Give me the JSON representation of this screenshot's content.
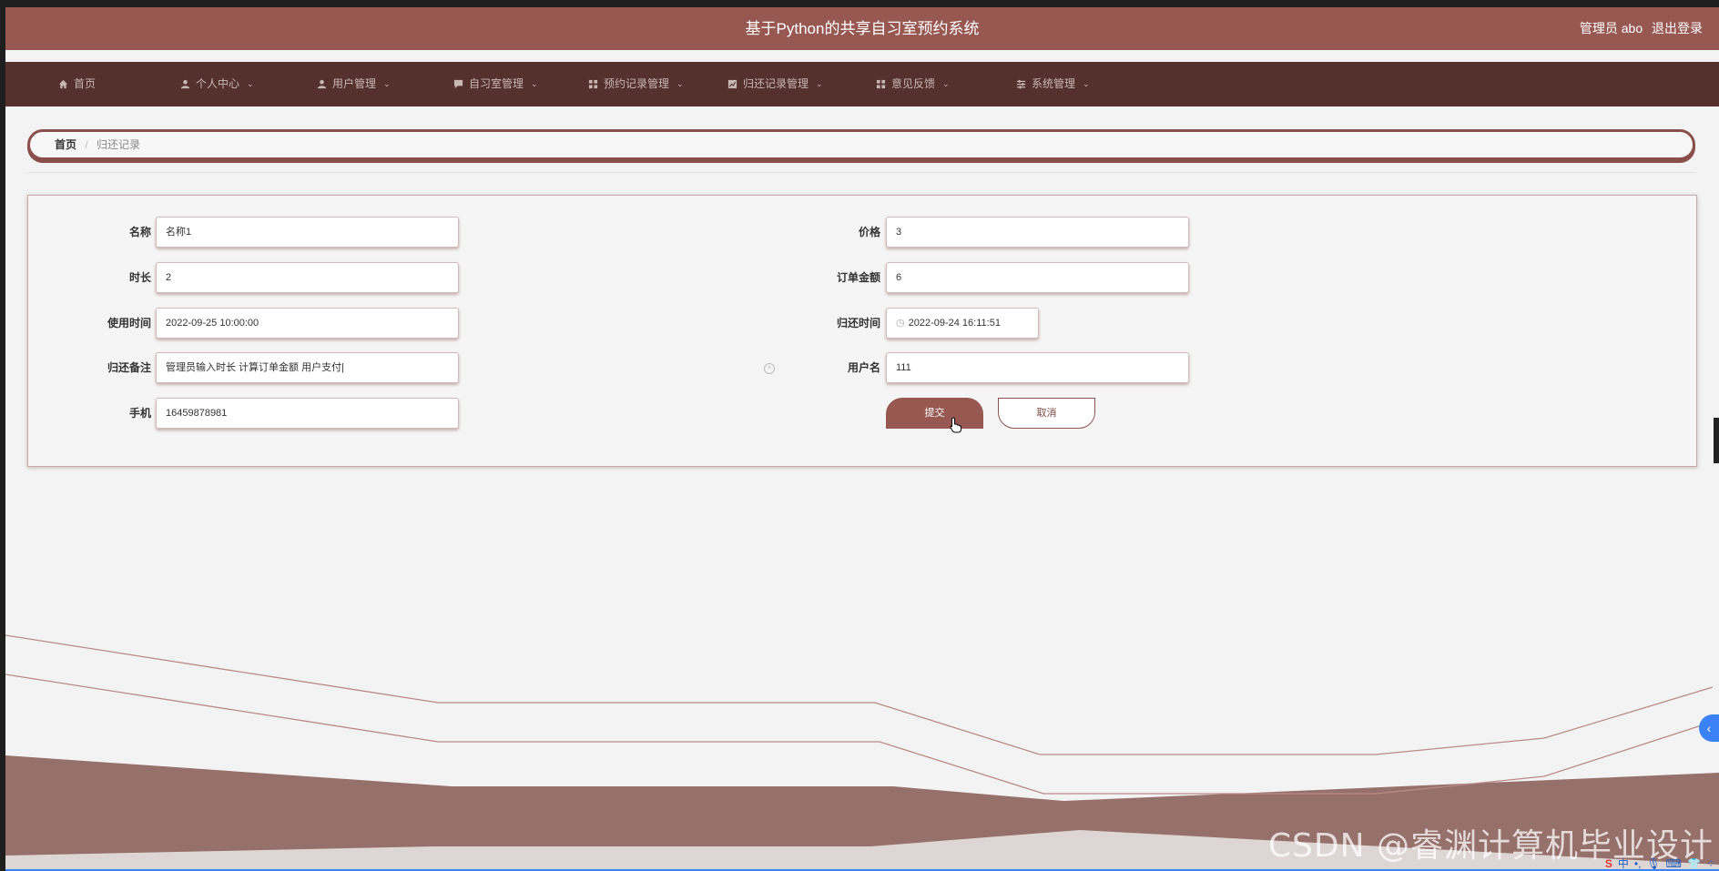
{
  "header": {
    "title": "基于Python的共享自习室预约系统",
    "user_label": "管理员 abo",
    "logout_label": "退出登录"
  },
  "nav": {
    "items": [
      {
        "label": "首页",
        "icon": "home-icon",
        "caret": false
      },
      {
        "label": "个人中心",
        "icon": "user-icon",
        "caret": true
      },
      {
        "label": "用户管理",
        "icon": "users-icon",
        "caret": true
      },
      {
        "label": "自习室管理",
        "icon": "chat-icon",
        "caret": true
      },
      {
        "label": "预约记录管理",
        "icon": "grid-icon",
        "caret": true
      },
      {
        "label": "归还记录管理",
        "icon": "chart-icon",
        "caret": true
      },
      {
        "label": "意见反馈",
        "icon": "grid-icon",
        "caret": true
      },
      {
        "label": "系统管理",
        "icon": "sliders-icon",
        "caret": true
      }
    ]
  },
  "breadcrumb": {
    "home": "首页",
    "separator": "/",
    "current": "归还记录"
  },
  "form": {
    "name": {
      "label": "名称",
      "value": "名称1"
    },
    "price": {
      "label": "价格",
      "value": "3"
    },
    "duration": {
      "label": "时长",
      "value": "2"
    },
    "order_amount": {
      "label": "订单金额",
      "value": "6"
    },
    "use_time": {
      "label": "使用时间",
      "value": "2022-09-25 10:00:00"
    },
    "return_time": {
      "label": "归还时间",
      "value": "2022-09-24 16:11:51"
    },
    "return_note": {
      "label": "归还备注",
      "value": "管理员输入时长 计算订单金额 用户支付|"
    },
    "username": {
      "label": "用户名",
      "value": "111"
    },
    "phone": {
      "label": "手机",
      "value": "16459878981"
    },
    "submit_label": "提交",
    "cancel_label": "取消"
  },
  "watermark": "CSDN @睿渊计算机毕业设计",
  "taskbar": {
    "ime": "中"
  },
  "colors": {
    "brand": "#985852",
    "nav_bg": "#54312c",
    "wave_fill": "#96706b",
    "wave_line": "#b98a86"
  }
}
